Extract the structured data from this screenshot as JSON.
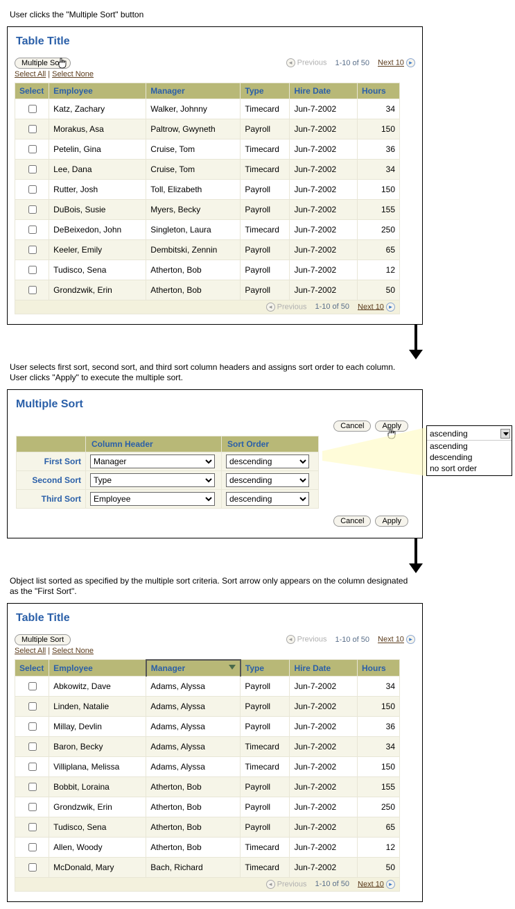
{
  "captions": {
    "step1": "User clicks the \"Multiple Sort\" button",
    "step2": "User selects first sort, second sort, and third sort column headers and assigns sort order to each column. User clicks \"Apply\" to execute the multiple sort.",
    "step3": "Object list sorted as specified by the multiple sort criteria.  Sort arrow only appears on the column designated as the \"First Sort\"."
  },
  "table": {
    "title": "Table Title",
    "multiple_sort": "Multiple Sort",
    "select_all": "Select All",
    "select_none": "Select None",
    "previous": "Previous",
    "next": "Next 10",
    "range": "1-10 of 50",
    "headers": [
      "Select",
      "Employee",
      "Manager",
      "Type",
      "Hire Date",
      "Hours"
    ]
  },
  "rows_before": [
    {
      "emp": "Katz, Zachary",
      "mgr": "Walker, Johnny",
      "type": "Timecard",
      "date": "Jun-7-2002",
      "hours": "34"
    },
    {
      "emp": "Morakus, Asa",
      "mgr": "Paltrow, Gwyneth",
      "type": "Payroll",
      "date": "Jun-7-2002",
      "hours": "150"
    },
    {
      "emp": "Petelin, Gina",
      "mgr": "Cruise, Tom",
      "type": "Timecard",
      "date": "Jun-7-2002",
      "hours": "36"
    },
    {
      "emp": "Lee, Dana",
      "mgr": "Cruise, Tom",
      "type": "Timecard",
      "date": "Jun-7-2002",
      "hours": "34"
    },
    {
      "emp": "Rutter, Josh",
      "mgr": "Toll, Elizabeth",
      "type": "Payroll",
      "date": "Jun-7-2002",
      "hours": "150"
    },
    {
      "emp": "DuBois, Susie",
      "mgr": "Myers, Becky",
      "type": "Payroll",
      "date": "Jun-7-2002",
      "hours": "155"
    },
    {
      "emp": "DeBeixedon, John",
      "mgr": "Singleton, Laura",
      "type": "Timecard",
      "date": "Jun-7-2002",
      "hours": "250"
    },
    {
      "emp": "Keeler, Emily",
      "mgr": "Dembitski, Zennin",
      "type": "Payroll",
      "date": "Jun-7-2002",
      "hours": "65"
    },
    {
      "emp": "Tudisco, Sena",
      "mgr": "Atherton, Bob",
      "type": "Payroll",
      "date": "Jun-7-2002",
      "hours": "12"
    },
    {
      "emp": "Grondzwik, Erin",
      "mgr": "Atherton, Bob",
      "type": "Payroll",
      "date": "Jun-7-2002",
      "hours": "50"
    }
  ],
  "rows_after": [
    {
      "emp": "Abkowitz, Dave",
      "mgr": "Adams, Alyssa",
      "type": "Payroll",
      "date": "Jun-7-2002",
      "hours": "34"
    },
    {
      "emp": "Linden, Natalie",
      "mgr": "Adams, Alyssa",
      "type": "Payroll",
      "date": "Jun-7-2002",
      "hours": "150"
    },
    {
      "emp": "Millay, Devlin",
      "mgr": "Adams, Alyssa",
      "type": "Payroll",
      "date": "Jun-7-2002",
      "hours": "36"
    },
    {
      "emp": "Baron, Becky",
      "mgr": "Adams, Alyssa",
      "type": "Timecard",
      "date": "Jun-7-2002",
      "hours": "34"
    },
    {
      "emp": "Villiplana, Melissa",
      "mgr": "Adams, Alyssa",
      "type": "Timecard",
      "date": "Jun-7-2002",
      "hours": "150"
    },
    {
      "emp": "Bobbit, Loraina",
      "mgr": "Atherton, Bob",
      "type": "Payroll",
      "date": "Jun-7-2002",
      "hours": "155"
    },
    {
      "emp": "Grondzwik, Erin",
      "mgr": "Atherton, Bob",
      "type": "Payroll",
      "date": "Jun-7-2002",
      "hours": "250"
    },
    {
      "emp": "Tudisco, Sena",
      "mgr": "Atherton, Bob",
      "type": "Payroll",
      "date": "Jun-7-2002",
      "hours": "65"
    },
    {
      "emp": "Allen, Woody",
      "mgr": "Atherton, Bob",
      "type": "Timecard",
      "date": "Jun-7-2002",
      "hours": "12"
    },
    {
      "emp": "McDonald, Mary",
      "mgr": "Bach, Richard",
      "type": "Timecard",
      "date": "Jun-7-2002",
      "hours": "50"
    }
  ],
  "sort_dialog": {
    "title": "Multiple Sort",
    "cancel": "Cancel",
    "apply": "Apply",
    "col_header": "Column Header",
    "sort_order": "Sort Order",
    "rows": [
      {
        "label": "First Sort",
        "col": "Manager",
        "order": "descending"
      },
      {
        "label": "Second Sort",
        "col": "Type",
        "order": "descending"
      },
      {
        "label": "Third Sort",
        "col": "Employee",
        "order": "descending"
      }
    ]
  },
  "dropdown": {
    "selected": "ascending",
    "options": [
      "ascending",
      "descending",
      "no sort order"
    ]
  }
}
